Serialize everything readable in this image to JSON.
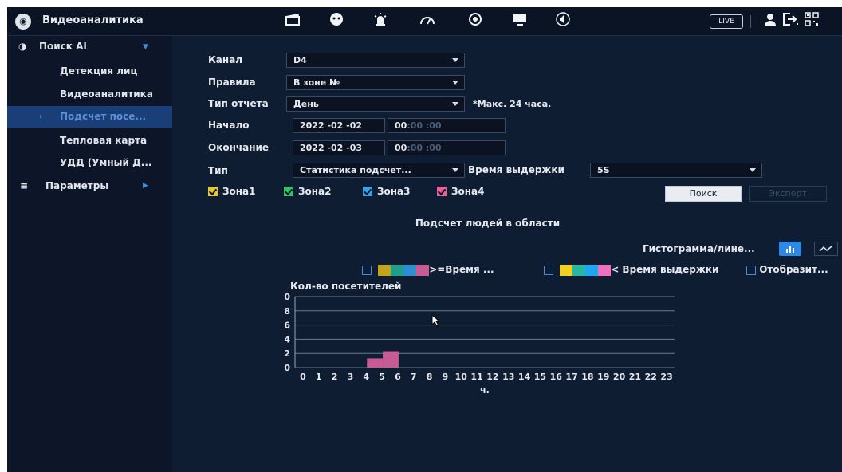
{
  "topbar": {
    "title": "Видеоаналитика",
    "icons": [
      "clapper-icon",
      "face-icon",
      "alarm-icon",
      "gauge-icon",
      "record-icon",
      "monitor-icon",
      "speaker-icon"
    ],
    "live_label": "LIVE",
    "right_icons": [
      "user-icon",
      "logout-icon",
      "qr-icon"
    ]
  },
  "sidebar": {
    "search_ai": "Поиск AI",
    "items": [
      "Детекция лиц",
      "Видеоаналитика",
      "Подсчет посе...",
      "Тепловая карта",
      "УДД (Умный Д..."
    ],
    "active_index": 2,
    "params": "Параметры"
  },
  "form": {
    "channel_label": "Канал",
    "channel_value": "D4",
    "rules_label": "Правила",
    "rules_value": "В зоне №",
    "report_label": "Тип отчета",
    "report_value": "День",
    "report_note": "*Макс. 24 часа.",
    "start_label": "Начало",
    "start_date": "2022 -02 -02",
    "start_hh": "00",
    "start_mmss": ":00 :00",
    "end_label": "Окончание",
    "end_date": "2022 -02 -03",
    "end_hh": "00",
    "end_mmss": ":00 :00",
    "type_label": "Тип",
    "type_value": "Статистика подсчет...",
    "dwell_label": "Время выдержки",
    "dwell_value": "5S"
  },
  "zones": [
    {
      "label": "Зона1",
      "color": "#e6c832"
    },
    {
      "label": "Зона2",
      "color": "#2fc46a"
    },
    {
      "label": "Зона3",
      "color": "#3aa0e8"
    },
    {
      "label": "Зона4",
      "color": "#e8609a"
    }
  ],
  "buttons": {
    "search": "Поиск",
    "export": "Экспорт"
  },
  "chart_title": "Подсчет людей в области",
  "chart_mode_label": "Гистограмма/лине...",
  "legend": {
    "ge_label": ">=Время ...",
    "lt_label": "< Время выдержки",
    "display_label": "Отобразит...",
    "colors_ge": [
      "#c3a31a",
      "#1e9f8c",
      "#2b8fd0",
      "#c85a96"
    ],
    "colors_lt": [
      "#f0d020",
      "#26b8a0",
      "#1aa8f0",
      "#f070c0"
    ]
  },
  "chart_data": {
    "type": "bar",
    "ylabel": "Кол-во посетителей",
    "xlabel": "ч.",
    "ylim": [
      0,
      10
    ],
    "yticks": [
      0,
      2,
      4,
      6,
      8,
      10
    ],
    "categories": [
      "0",
      "1",
      "2",
      "3",
      "4",
      "5",
      "6",
      "7",
      "8",
      "9",
      "10",
      "11",
      "12",
      "13",
      "14",
      "15",
      "16",
      "17",
      "18",
      "19",
      "20",
      "21",
      "22",
      "23"
    ],
    "series": [
      {
        "color": "#c85a96",
        "values": [
          0,
          0,
          0,
          0,
          1.3,
          2.3,
          0,
          0,
          0,
          0,
          0,
          0,
          0,
          0,
          0,
          0,
          0,
          0,
          0,
          0,
          0,
          0,
          0,
          0
        ]
      }
    ]
  }
}
